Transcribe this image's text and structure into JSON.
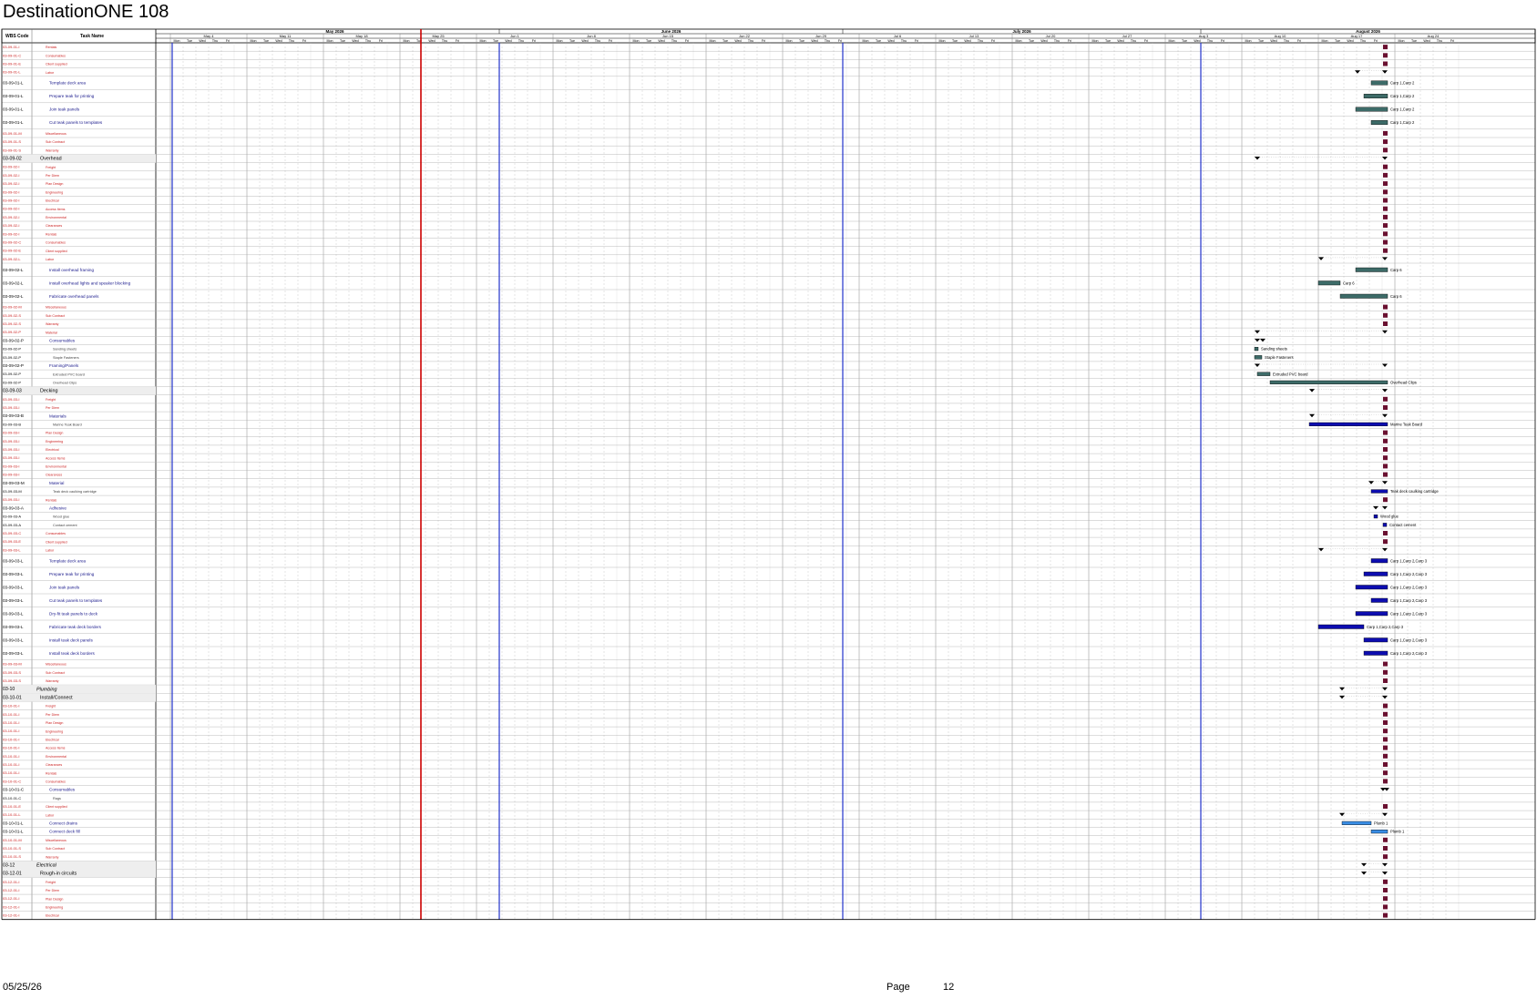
{
  "app": {
    "title": "DestinationONE 108"
  },
  "header": {
    "wbs": "WBS Code",
    "task": "Task Name"
  },
  "months": [
    "May 2026",
    "June 2026",
    "July 2026",
    "August 2026"
  ],
  "weeks": [
    "May 4",
    "May 11",
    "May 18",
    "May 25",
    "Jun 1",
    "Jun 8",
    "Jun 15",
    "Jun 22",
    "Jun 29",
    "Jul 6",
    "Jul 13",
    "Jul 20",
    "Jul 27",
    "Aug 3",
    "Aug 10",
    "Aug 17",
    "Aug 24"
  ],
  "days": [
    "Mon",
    "Tue",
    "Wed",
    "Thu",
    "Fri"
  ],
  "colors": {
    "red": "#cc2222",
    "blue": "#1a1a8c",
    "grid": "#aaaaaa",
    "teal": "#3d6b68",
    "navy": "#0d0db0",
    "lightblue": "#3a8ee6",
    "marker": "#6a1030",
    "today": "#cc0000",
    "milestone": "#2233cc"
  },
  "rows": [
    {
      "w": "03-09-01-I",
      "t": "Rentals",
      "k": "r",
      "m": 1
    },
    {
      "w": "03-09-01-C",
      "t": "Consumables",
      "k": "r",
      "m": 1
    },
    {
      "w": "03-09-01-E",
      "t": "Client supplied",
      "k": "r",
      "m": 1
    },
    {
      "w": "03-09-01-L",
      "t": "Labor",
      "k": "r",
      "s": [
        1490,
        1520
      ]
    },
    {
      "w": "03-09-01-L",
      "t": "Template deck area",
      "k": "b",
      "h": 1,
      "bar": [
        1505,
        1523,
        "teal"
      ],
      "lbl": "Carp 1,Carp 2"
    },
    {
      "w": "03-09-01-L",
      "t": "Prepare teak for printing",
      "k": "b",
      "h": 1,
      "bar": [
        1497,
        1523,
        "teal"
      ],
      "lbl": "Carp 1,Carp 2"
    },
    {
      "w": "03-09-01-L",
      "t": "Join teak panels",
      "k": "b",
      "h": 1,
      "bar": [
        1488,
        1523,
        "teal"
      ],
      "lbl": "Carp 1,Carp 2"
    },
    {
      "w": "03-09-01-L",
      "t": "Cut teak panels to templates",
      "k": "b",
      "h": 1,
      "bar": [
        1505,
        1523,
        "teal"
      ],
      "lbl": "Carp 1,Carp 2"
    },
    {
      "w": "03-09-01-M",
      "t": "Miscellaneous",
      "k": "r",
      "m": 1
    },
    {
      "w": "03-09-01-S",
      "t": "Sub Contract",
      "k": "r",
      "m": 1
    },
    {
      "w": "03-09-01-S",
      "t": "Warranty",
      "k": "r",
      "m": 1
    },
    {
      "w": "03-09-02",
      "t": "Overhead",
      "k": "s",
      "s": [
        1380,
        1520
      ]
    },
    {
      "w": "03-09-02-I",
      "t": "Freight",
      "k": "r",
      "m": 1
    },
    {
      "w": "03-09-02-I",
      "t": "Per Diem",
      "k": "r",
      "m": 1
    },
    {
      "w": "03-09-02-I",
      "t": "Plan Design",
      "k": "r",
      "m": 1
    },
    {
      "w": "03-09-02-I",
      "t": "Engineering",
      "k": "r",
      "m": 1
    },
    {
      "w": "03-09-02-I",
      "t": "Electrical",
      "k": "r",
      "m": 1
    },
    {
      "w": "03-09-02-I",
      "t": "Access Items",
      "k": "r",
      "m": 1
    },
    {
      "w": "03-09-02-I",
      "t": "Environmental",
      "k": "r",
      "m": 1
    },
    {
      "w": "03-09-02-I",
      "t": "Clearances",
      "k": "r",
      "m": 1
    },
    {
      "w": "03-09-02-I",
      "t": "Rentals",
      "k": "r",
      "m": 1
    },
    {
      "w": "03-09-02-C",
      "t": "Consumables",
      "k": "r",
      "m": 1
    },
    {
      "w": "03-09-02-E",
      "t": "Client supplied",
      "k": "r",
      "m": 1
    },
    {
      "w": "03-09-02-L",
      "t": "Labor",
      "k": "r",
      "s": [
        1450,
        1520
      ]
    },
    {
      "w": "03-09-02-L",
      "t": "Install overhead framing",
      "k": "b",
      "h": 1,
      "bar": [
        1488,
        1523,
        "teal"
      ],
      "lbl": "Carp 6"
    },
    {
      "w": "03-09-02-L",
      "t": "Install overhead lights and speaker blocking",
      "k": "b",
      "h": 1,
      "bar": [
        1447,
        1471,
        "teal"
      ],
      "lbl": "Carp 6"
    },
    {
      "w": "03-09-02-L",
      "t": "Fabricate overhead panels",
      "k": "b",
      "h": 1,
      "bar": [
        1471,
        1523,
        "teal"
      ],
      "lbl": "Carp 6"
    },
    {
      "w": "03-09-02-M",
      "t": "Miscellaneous",
      "k": "r",
      "m": 1
    },
    {
      "w": "03-09-02-S",
      "t": "Sub Contract",
      "k": "r",
      "m": 1
    },
    {
      "w": "03-09-02-S",
      "t": "Warranty",
      "k": "r",
      "m": 1
    },
    {
      "w": "03-09-02-P",
      "t": "Material",
      "k": "r",
      "s": [
        1380,
        1520
      ]
    },
    {
      "w": "03-09-02-P",
      "t": "Consumables",
      "k": "b",
      "s": [
        1380,
        1386
      ]
    },
    {
      "w": "03-09-02-P",
      "t": "Sanding sheets",
      "k": "g",
      "bar": [
        1377,
        1381,
        "teal"
      ],
      "lbl": "Sanding sheets"
    },
    {
      "w": "03-09-02-P",
      "t": "Staple Fasteners",
      "k": "g",
      "bar": [
        1377,
        1385,
        "teal"
      ],
      "lbl": "Staple Fasteners"
    },
    {
      "w": "03-09-02-P",
      "t": "Framing/Panels",
      "k": "b",
      "s": [
        1380,
        1520
      ]
    },
    {
      "w": "03-09-02-P",
      "t": "Extruded PVC board",
      "k": "g",
      "bar": [
        1380,
        1394,
        "teal"
      ],
      "lbl": "Extruded PVC board"
    },
    {
      "w": "03-09-02-P",
      "t": "Overhead Clips",
      "k": "g",
      "bar": [
        1394,
        1523,
        "teal"
      ],
      "lbl": "Overhead Clips"
    },
    {
      "w": "03-09-03",
      "t": "Decking",
      "k": "s",
      "s": [
        1440,
        1520
      ]
    },
    {
      "w": "03-09-03-I",
      "t": "Freight",
      "k": "r",
      "m": 1
    },
    {
      "w": "03-09-03-I",
      "t": "Per Diem",
      "k": "r",
      "m": 1
    },
    {
      "w": "03-09-03-B",
      "t": "Materials",
      "k": "b",
      "s": [
        1440,
        1520
      ]
    },
    {
      "w": "03-09-03-B",
      "t": "Marine Teak Board",
      "k": "g",
      "bar": [
        1437,
        1523,
        "navy"
      ],
      "lbl": "Marine Teak Board"
    },
    {
      "w": "03-09-03-I",
      "t": "Plan Design",
      "k": "r",
      "m": 1
    },
    {
      "w": "03-09-03-I",
      "t": "Engineering",
      "k": "r",
      "m": 1
    },
    {
      "w": "03-09-03-I",
      "t": "Electrical",
      "k": "r",
      "m": 1
    },
    {
      "w": "03-09-03-I",
      "t": "Access Items",
      "k": "r",
      "m": 1
    },
    {
      "w": "03-09-03-I",
      "t": "Environmental",
      "k": "r",
      "m": 1
    },
    {
      "w": "03-09-03-I",
      "t": "Clearances",
      "k": "r",
      "m": 1
    },
    {
      "w": "03-09-03-M",
      "t": "Material",
      "k": "b",
      "s": [
        1505,
        1520
      ]
    },
    {
      "w": "03-09-03-M",
      "t": "Teak deck caulking cartridge",
      "k": "g",
      "bar": [
        1505,
        1523,
        "navy"
      ],
      "lbl": "Teak deck caulking cartridge"
    },
    {
      "w": "03-09-03-I",
      "t": "Rentals",
      "k": "r",
      "m": 1
    },
    {
      "w": "03-09-03-A",
      "t": "Adhesive",
      "k": "b",
      "s": [
        1510,
        1520
      ]
    },
    {
      "w": "03-09-03-A",
      "t": "Wood glue",
      "k": "g",
      "bar": [
        1508,
        1512,
        "navy"
      ],
      "lbl": "Wood glue"
    },
    {
      "w": "03-09-03-A",
      "t": "Contact cement",
      "k": "g",
      "bar": [
        1518,
        1522,
        "navy"
      ],
      "lbl": "Contact cement"
    },
    {
      "w": "03-09-03-C",
      "t": "Consumables",
      "k": "r",
      "m": 1
    },
    {
      "w": "03-09-03-E",
      "t": "Client supplied",
      "k": "r",
      "m": 1
    },
    {
      "w": "03-09-03-L",
      "t": "Labor",
      "k": "r",
      "s": [
        1450,
        1520
      ]
    },
    {
      "w": "03-09-03-L",
      "t": "Template deck area",
      "k": "b",
      "h": 1,
      "bar": [
        1505,
        1523,
        "navy"
      ],
      "lbl": "Carp 1,Carp 2,Carp 3"
    },
    {
      "w": "03-09-03-L",
      "t": "Prepare teak for printing",
      "k": "b",
      "h": 1,
      "bar": [
        1497,
        1523,
        "navy"
      ],
      "lbl": "Carp 1,Carp 2,Carp 3"
    },
    {
      "w": "03-09-03-L",
      "t": "Join teak panels",
      "k": "b",
      "h": 1,
      "bar": [
        1488,
        1523,
        "navy"
      ],
      "lbl": "Carp 1,Carp 2,Carp 3"
    },
    {
      "w": "03-09-03-L",
      "t": "Cut teak panels to templates",
      "k": "b",
      "h": 1,
      "bar": [
        1505,
        1523,
        "navy"
      ],
      "lbl": "Carp 1,Carp 2,Carp 3"
    },
    {
      "w": "03-09-03-L",
      "t": "Dry-fit teak panels to deck",
      "k": "b",
      "h": 1,
      "bar": [
        1488,
        1523,
        "navy"
      ],
      "lbl": "Carp 1,Carp 2,Carp 3"
    },
    {
      "w": "03-09-03-L",
      "t": "Fabricate teak deck borders",
      "k": "b",
      "h": 1,
      "bar": [
        1447,
        1497,
        "navy"
      ],
      "lbl": "Carp 1,Carp 2,Carp 3"
    },
    {
      "w": "03-09-03-L",
      "t": "Install teak deck panels",
      "k": "b",
      "h": 1,
      "bar": [
        1497,
        1523,
        "navy"
      ],
      "lbl": "Carp 1,Carp 2,Carp 3"
    },
    {
      "w": "03-09-03-L",
      "t": "Install teak deck borders",
      "k": "b",
      "h": 1,
      "bar": [
        1497,
        1523,
        "navy"
      ],
      "lbl": "Carp 1,Carp 2,Carp 3"
    },
    {
      "w": "03-09-03-M",
      "t": "Miscellaneous",
      "k": "r",
      "m": 1
    },
    {
      "w": "03-09-03-S",
      "t": "Sub Contract",
      "k": "r",
      "m": 1
    },
    {
      "w": "03-09-03-S",
      "t": "Warranty",
      "k": "r",
      "m": 1
    },
    {
      "w": "03-10",
      "t": "Plumbing",
      "k": "i",
      "s": [
        1473,
        1520
      ]
    },
    {
      "w": "03-10-01",
      "t": "Install/Connect",
      "k": "s",
      "s": [
        1473,
        1520
      ]
    },
    {
      "w": "03-10-01-I",
      "t": "Freight",
      "k": "r",
      "m": 1
    },
    {
      "w": "03-10-01-I",
      "t": "Per Diem",
      "k": "r",
      "m": 1
    },
    {
      "w": "03-10-01-I",
      "t": "Plan Design",
      "k": "r",
      "m": 1
    },
    {
      "w": "03-10-01-I",
      "t": "Engineering",
      "k": "r",
      "m": 1
    },
    {
      "w": "03-10-01-I",
      "t": "Electrical",
      "k": "r",
      "m": 1
    },
    {
      "w": "03-10-01-I",
      "t": "Access Items",
      "k": "r",
      "m": 1
    },
    {
      "w": "03-10-01-I",
      "t": "Environmental",
      "k": "r",
      "m": 1
    },
    {
      "w": "03-10-01-I",
      "t": "Clearances",
      "k": "r",
      "m": 1
    },
    {
      "w": "03-10-01-I",
      "t": "Rentals",
      "k": "r",
      "m": 1
    },
    {
      "w": "03-10-01-C",
      "t": "Consumables",
      "k": "r",
      "m": 1
    },
    {
      "w": "03-10-01-C",
      "t": "Consumables",
      "k": "b",
      "s": [
        1518,
        1522
      ]
    },
    {
      "w": "03-10-01-C",
      "t": "Rags",
      "k": "g"
    },
    {
      "w": "03-10-01-E",
      "t": "Client supplied",
      "k": "r",
      "m": 1
    },
    {
      "w": "03-10-01-L",
      "t": "Labor",
      "k": "r",
      "s": [
        1473,
        1520
      ]
    },
    {
      "w": "03-10-01-L",
      "t": "Connect drains",
      "k": "b",
      "bar": [
        1473,
        1505,
        "lightblue"
      ],
      "lbl": "Plumb 1"
    },
    {
      "w": "03-10-01-L",
      "t": "Connect deck fill",
      "k": "b",
      "bar": [
        1505,
        1523,
        "lightblue"
      ],
      "lbl": "Plumb 1"
    },
    {
      "w": "03-10-01-M",
      "t": "Miscellaneous",
      "k": "r",
      "m": 1
    },
    {
      "w": "03-10-01-S",
      "t": "Sub Contract",
      "k": "r",
      "m": 1
    },
    {
      "w": "03-10-01-S",
      "t": "Warranty",
      "k": "r",
      "m": 1
    },
    {
      "w": "03-12",
      "t": "Electrical",
      "k": "i",
      "s": [
        1497,
        1520
      ]
    },
    {
      "w": "03-12-01",
      "t": "Rough-in circuits",
      "k": "s",
      "s": [
        1497,
        1520
      ]
    },
    {
      "w": "03-12-01-I",
      "t": "Freight",
      "k": "r",
      "m": 1
    },
    {
      "w": "03-12-01-I",
      "t": "Per Diem",
      "k": "r",
      "m": 1
    },
    {
      "w": "03-12-01-I",
      "t": "Plan Design",
      "k": "r",
      "m": 1
    },
    {
      "w": "03-12-01-I",
      "t": "Engineering",
      "k": "r",
      "m": 1
    },
    {
      "w": "03-12-01-I",
      "t": "Electrical",
      "k": "r",
      "m": 1
    }
  ],
  "footer": {
    "date": "05/25/26",
    "page_label": "Page",
    "page_num": "12"
  }
}
